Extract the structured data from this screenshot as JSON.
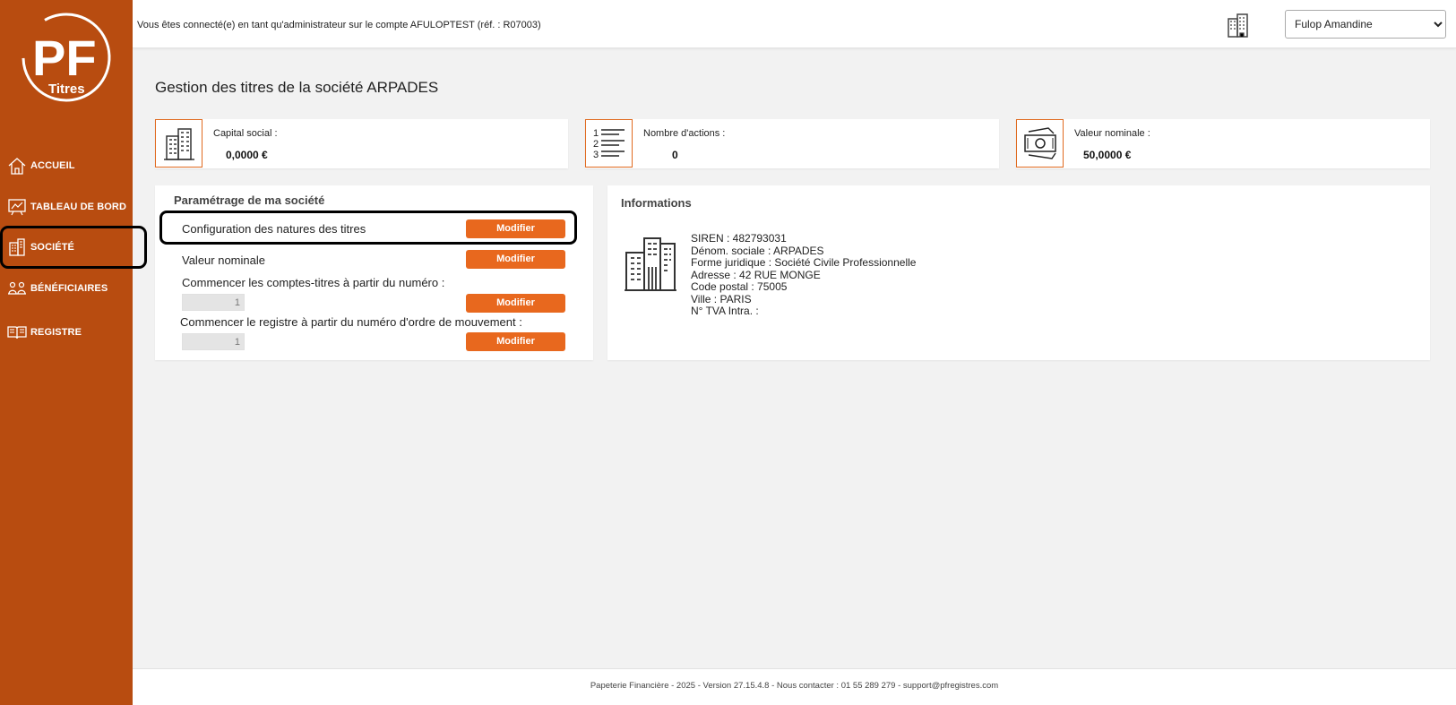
{
  "app": {
    "logo_text": "PF",
    "logo_sub": "Titres",
    "brand_color": "#b84c10",
    "accent_color": "#e8681e"
  },
  "sidebar": {
    "items": [
      {
        "label": "ACCUEIL",
        "icon": "home-icon"
      },
      {
        "label": "TABLEAU DE BORD",
        "icon": "dashboard-icon"
      },
      {
        "label": "SOCIÉTÉ",
        "icon": "company-icon",
        "active": true
      },
      {
        "label": "BÉNÉFICIAIRES",
        "icon": "people-icon"
      },
      {
        "label": "REGISTRE",
        "icon": "book-icon"
      }
    ]
  },
  "header": {
    "connection_text": "Vous êtes connecté(e) en tant qu'administrateur sur le compte AFULOPTEST (réf. : R07003)",
    "user_select_value": "Fulop Amandine"
  },
  "page": {
    "title": "Gestion des titres de la société ARPADES"
  },
  "stats": [
    {
      "label": "Capital social :",
      "value": "0,0000 €",
      "icon": "building-icon"
    },
    {
      "label": "Nombre d'actions :",
      "value": "0",
      "icon": "numbered-list-icon"
    },
    {
      "label": "Valeur nominale :",
      "value": "50,0000 €",
      "icon": "banknote-icon"
    }
  ],
  "settings": {
    "title": "Paramétrage de ma société",
    "rows": [
      {
        "label": "Configuration des natures des titres",
        "button": "Modifier"
      },
      {
        "label": "Valeur nominale",
        "button": "Modifier"
      },
      {
        "label": "Commencer les comptes-titres à partir du numéro :",
        "button": "Modifier",
        "input_value": "1"
      },
      {
        "label": "Commencer le registre à partir du numéro d'ordre de mouvement :",
        "button": "Modifier",
        "input_value": "1"
      }
    ]
  },
  "info": {
    "title": "Informations",
    "lines": [
      "SIREN : 482793031",
      "Dénom. sociale : ARPADES",
      "Forme juridique : Société Civile Professionnelle",
      "Adresse : 42 RUE MONGE",
      "Code postal : 75005",
      "Ville : PARIS",
      "N° TVA Intra. :"
    ]
  },
  "footer": {
    "text": "Papeterie Financière - 2025 - Version 27.15.4.8 - Nous contacter : 01 55 289 279 - support@pfregistres.com"
  }
}
